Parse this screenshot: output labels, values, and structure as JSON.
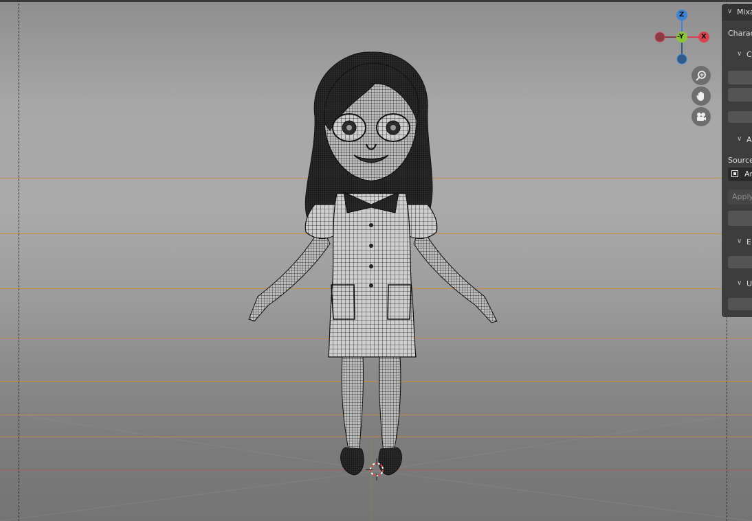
{
  "gizmo": {
    "z": "Z",
    "neg_y": "-Y",
    "x": "X",
    "icons": [
      "zoom-icon",
      "hand-pan-icon",
      "camera-icon"
    ],
    "colors": {
      "x": "#d9434f",
      "y": "#8cc43c",
      "z": "#3d83d6",
      "x_neg": "#8a3b43",
      "z_neg": "#2f5a8a"
    }
  },
  "panel": {
    "title": "Mixa",
    "character_label": "Charac",
    "section_c": "C",
    "section_a": "A",
    "source_label": "Source",
    "armature_value": "Ar",
    "apply_label": "Apply",
    "section_e": "E",
    "section_u": "U"
  },
  "scene": {
    "grid_line_color": "#c9893a",
    "x_axis_color": "#b5524a",
    "y_axis_color": "#6a9a3a"
  }
}
